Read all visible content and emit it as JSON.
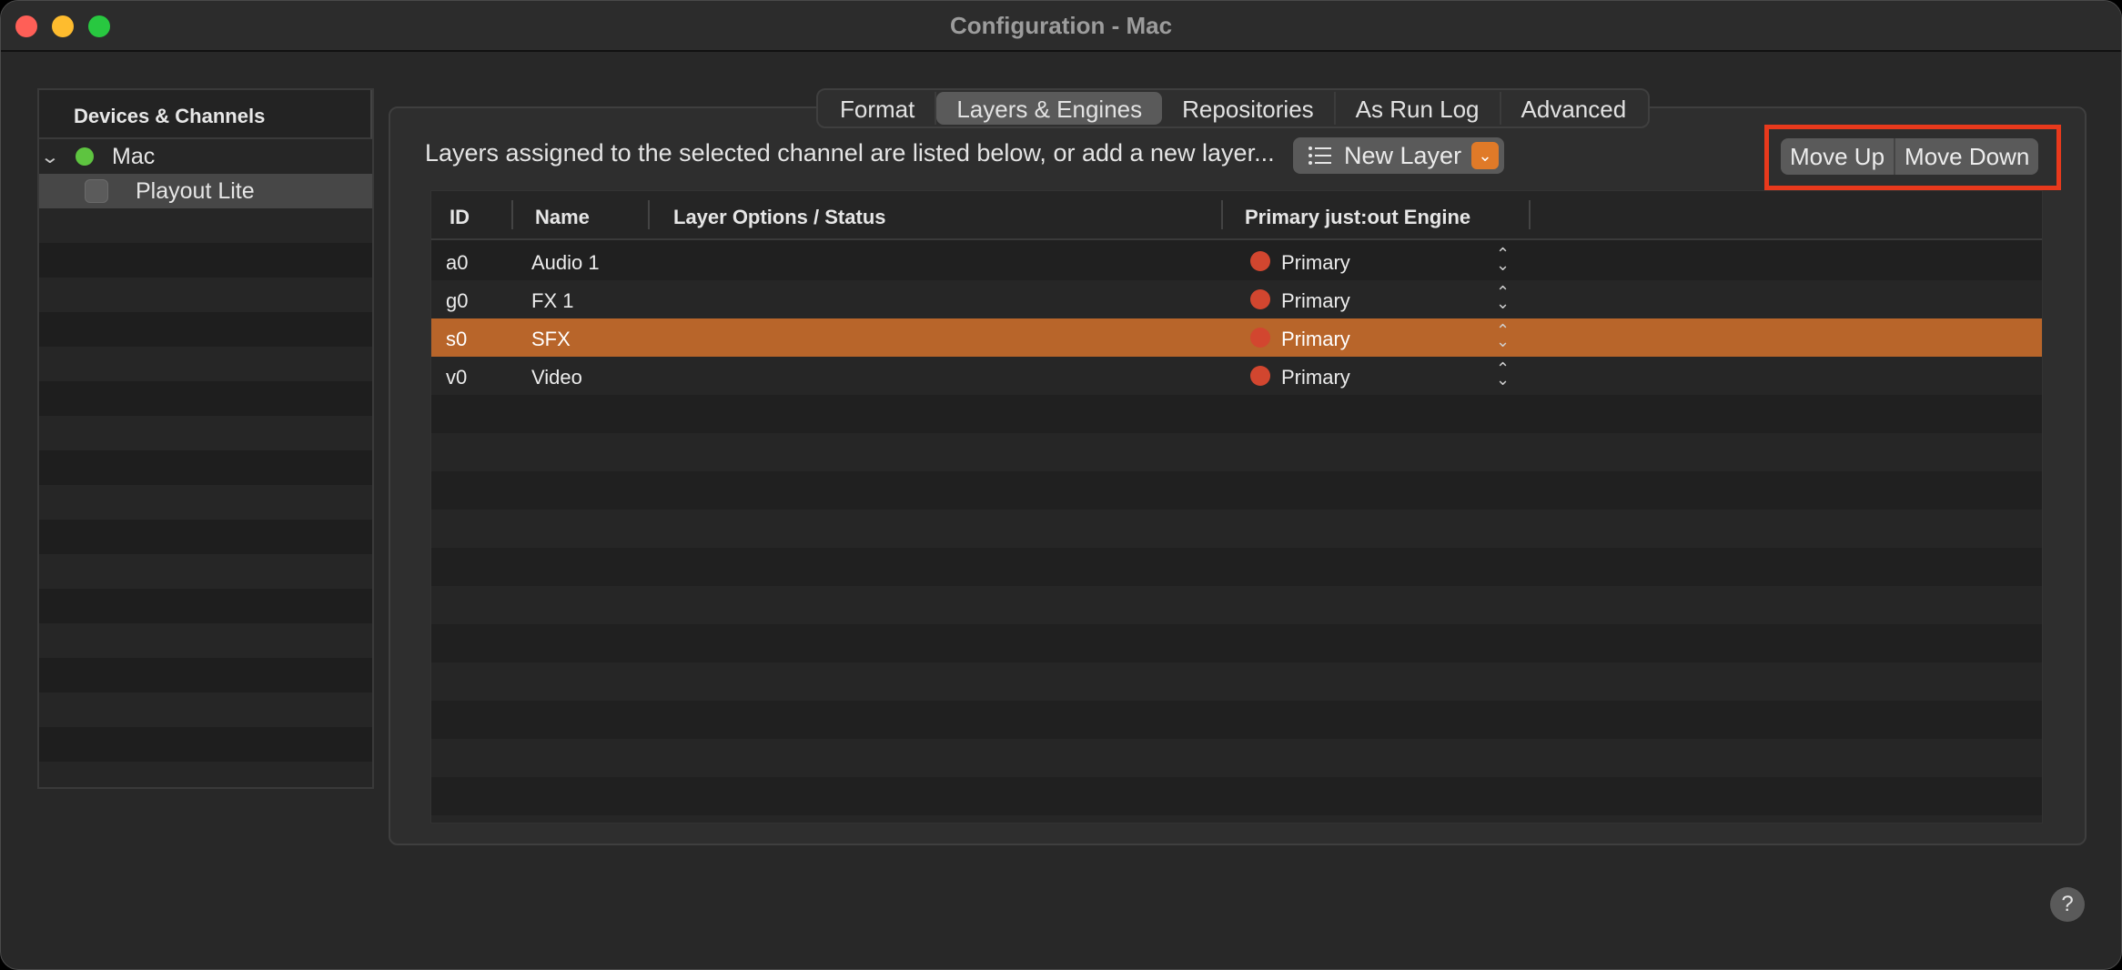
{
  "window": {
    "title": "Configuration - Mac"
  },
  "sidebar": {
    "header": "Devices & Channels",
    "device": {
      "label": "Mac",
      "status_color": "#5ec440"
    },
    "channel": {
      "label": "Playout Lite"
    }
  },
  "tabs": [
    {
      "label": "Format",
      "active": false
    },
    {
      "label": "Layers & Engines",
      "active": true
    },
    {
      "label": "Repositories",
      "active": false
    },
    {
      "label": "As Run Log",
      "active": false
    },
    {
      "label": "Advanced",
      "active": false
    }
  ],
  "toolbar": {
    "info_text": "Layers assigned to the selected channel are listed below, or add a new layer...",
    "new_layer_label": "New Layer",
    "move_up_label": "Move Up",
    "move_down_label": "Move Down",
    "highlight_color": "#e8391c"
  },
  "table": {
    "columns": [
      "ID",
      "Name",
      "Layer Options / Status",
      "Primary just:out Engine"
    ],
    "rows": [
      {
        "id": "a0",
        "name": "Audio 1",
        "engine": "Primary",
        "selected": false
      },
      {
        "id": "g0",
        "name": "FX 1",
        "engine": "Primary",
        "selected": false
      },
      {
        "id": "s0",
        "name": "SFX",
        "engine": "Primary",
        "selected": true
      },
      {
        "id": "v0",
        "name": "Video",
        "engine": "Primary",
        "selected": false
      }
    ],
    "selection_color": "#b8652a",
    "engine_status_color": "#d2462f"
  },
  "help": {
    "label": "?"
  }
}
